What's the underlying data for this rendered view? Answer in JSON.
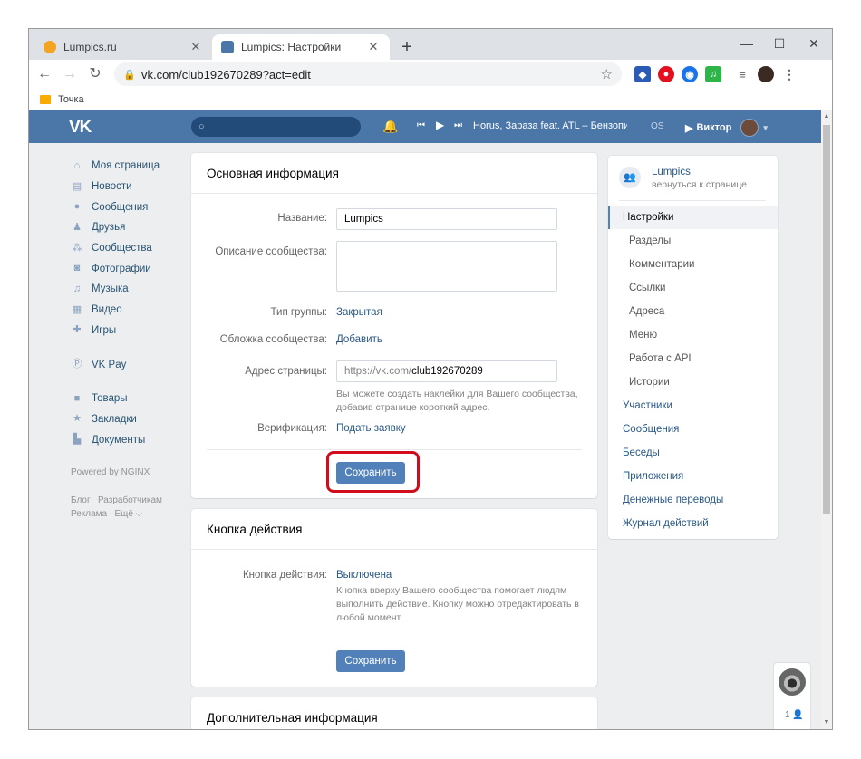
{
  "browser": {
    "tabs": [
      {
        "title": "Lumpics.ru",
        "active": false,
        "favicon_color": "#f4a423"
      },
      {
        "title": "Lumpics: Настройки",
        "active": true,
        "favicon_color": "#4a76a8"
      }
    ],
    "url": "vk.com/club192670289?act=edit",
    "bookmark": "Точка",
    "extension_colors": [
      "#2b5bb5",
      "#e3101f",
      "#1a73e8",
      "#2fb44a"
    ]
  },
  "vk_header": {
    "logo": "VK",
    "track": "Horus, Зараза feat. ATL – Бензопила",
    "os_label": "OS",
    "user_name": "Виктор"
  },
  "left_nav": {
    "items": [
      {
        "label": "Моя страница",
        "icon": "home-icon"
      },
      {
        "label": "Новости",
        "icon": "news-icon"
      },
      {
        "label": "Сообщения",
        "icon": "messages-icon"
      },
      {
        "label": "Друзья",
        "icon": "friends-icon"
      },
      {
        "label": "Сообщества",
        "icon": "communities-icon"
      },
      {
        "label": "Фотографии",
        "icon": "camera-icon"
      },
      {
        "label": "Музыка",
        "icon": "music-icon"
      },
      {
        "label": "Видео",
        "icon": "video-icon"
      },
      {
        "label": "Игры",
        "icon": "gamepad-icon"
      }
    ],
    "pay": {
      "label": "VK Pay",
      "icon": "vkpay-icon"
    },
    "items2": [
      {
        "label": "Товары",
        "icon": "bag-icon"
      },
      {
        "label": "Закладки",
        "icon": "star-icon"
      },
      {
        "label": "Документы",
        "icon": "document-icon"
      }
    ],
    "powered": "Powered by NGINX",
    "footer": [
      "Блог",
      "Разработчикам",
      "Реклама",
      "Ещё"
    ]
  },
  "basic_info": {
    "title": "Основная информация",
    "name_label": "Название:",
    "name_value": "Lumpics",
    "desc_label": "Описание сообщества:",
    "desc_value": "",
    "type_label": "Тип группы:",
    "type_value": "Закрытая",
    "cover_label": "Обложка сообщества:",
    "cover_value": "Добавить",
    "address_label": "Адрес страницы:",
    "address_prefix": "https://vk.com/",
    "address_value": "club192670289",
    "address_hint_1": "Вы можете создать наклейки для Вашего сообщества,",
    "address_hint_2": "добавив странице короткий адрес.",
    "verify_label": "Верификация:",
    "verify_value": "Подать заявку",
    "save_label": "Сохранить"
  },
  "action_button": {
    "title": "Кнопка действия",
    "label": "Кнопка действия:",
    "value": "Выключена",
    "hint_1": "Кнопка вверху Вашего сообщества помогает людям",
    "hint_2": "выполнить действие. Кнопку можно отредактировать в",
    "hint_3": "любой момент.",
    "save_label": "Сохранить"
  },
  "extra_info": {
    "title": "Дополнительная информация"
  },
  "right_menu": {
    "group_name": "Lumpics",
    "back_link": "вернуться к странице",
    "items": [
      {
        "label": "Настройки",
        "type": "active"
      },
      {
        "label": "Разделы",
        "type": "sub"
      },
      {
        "label": "Комментарии",
        "type": "sub"
      },
      {
        "label": "Ссылки",
        "type": "sub"
      },
      {
        "label": "Адреса",
        "type": "sub"
      },
      {
        "label": "Меню",
        "type": "sub"
      },
      {
        "label": "Работа с API",
        "type": "sub"
      },
      {
        "label": "Истории",
        "type": "sub"
      },
      {
        "label": "Участники",
        "type": "main"
      },
      {
        "label": "Сообщения",
        "type": "main"
      },
      {
        "label": "Беседы",
        "type": "main"
      },
      {
        "label": "Приложения",
        "type": "main"
      },
      {
        "label": "Денежные переводы",
        "type": "main"
      },
      {
        "label": "Журнал действий",
        "type": "main"
      }
    ]
  },
  "chat": {
    "count": "1"
  },
  "colors": {
    "vk_blue": "#4a76a8",
    "button_blue": "#5181b8",
    "highlight_red": "#d10d1d"
  }
}
